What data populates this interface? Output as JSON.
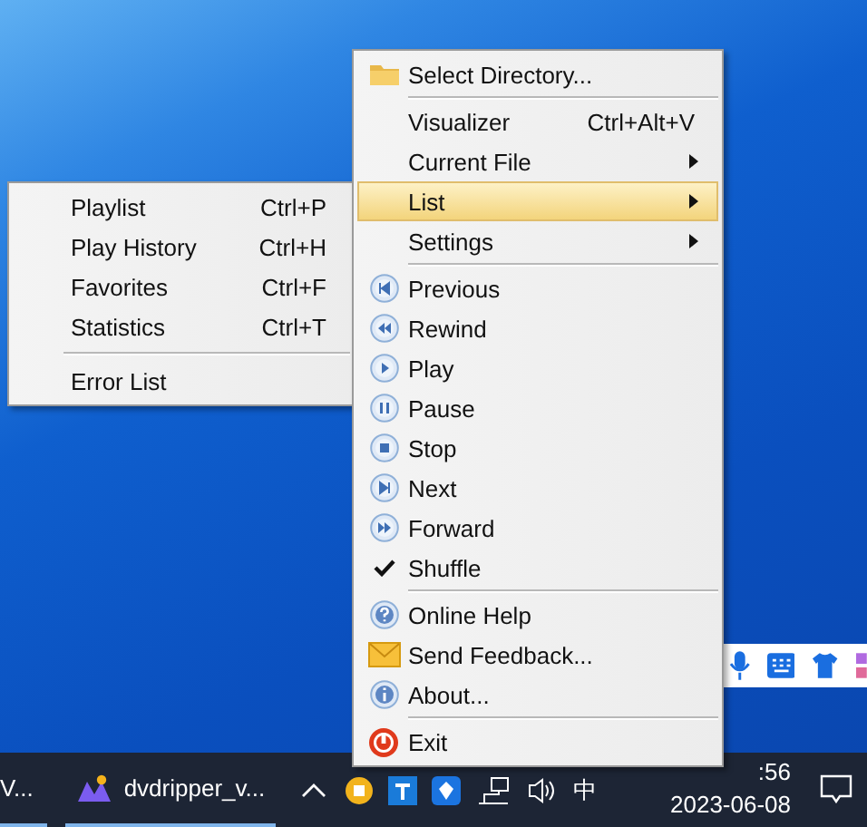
{
  "main_menu": {
    "items": [
      {
        "kind": "folder",
        "label": "Select Directory...",
        "selected": false,
        "checked": false
      },
      {
        "kind": "separator"
      },
      {
        "kind": "plain",
        "label": "Visualizer",
        "shortcut": "Ctrl+Alt+V",
        "selected": false,
        "checked": false
      },
      {
        "kind": "plain",
        "label": "Current File",
        "submenu": true,
        "selected": false,
        "checked": false
      },
      {
        "kind": "plain",
        "label": "List",
        "submenu": true,
        "selected": true,
        "checked": false
      },
      {
        "kind": "plain",
        "label": "Settings",
        "submenu": true,
        "selected": false,
        "checked": false
      },
      {
        "kind": "separator"
      },
      {
        "kind": "previous",
        "label": "Previous",
        "selected": false,
        "checked": false
      },
      {
        "kind": "rewind",
        "label": "Rewind",
        "selected": false,
        "checked": false
      },
      {
        "kind": "play",
        "label": "Play",
        "selected": false,
        "checked": false
      },
      {
        "kind": "pause",
        "label": "Pause",
        "selected": false,
        "checked": false
      },
      {
        "kind": "stop",
        "label": "Stop",
        "selected": false,
        "checked": false
      },
      {
        "kind": "next",
        "label": "Next",
        "selected": false,
        "checked": false
      },
      {
        "kind": "forward",
        "label": "Forward",
        "selected": false,
        "checked": false
      },
      {
        "kind": "plain",
        "label": "Shuffle",
        "selected": false,
        "checked": true
      },
      {
        "kind": "separator"
      },
      {
        "kind": "help",
        "label": "Online Help",
        "selected": false,
        "checked": false
      },
      {
        "kind": "mail",
        "label": "Send Feedback...",
        "selected": false,
        "checked": false
      },
      {
        "kind": "info",
        "label": "About...",
        "selected": false,
        "checked": false
      },
      {
        "kind": "separator"
      },
      {
        "kind": "exit",
        "label": "Exit",
        "selected": false,
        "checked": false
      }
    ]
  },
  "list_submenu": {
    "items": [
      {
        "kind": "plain",
        "label": "Playlist",
        "shortcut": "Ctrl+P",
        "selected": false
      },
      {
        "kind": "plain",
        "label": "Play History",
        "shortcut": "Ctrl+H",
        "selected": false
      },
      {
        "kind": "plain",
        "label": "Favorites",
        "shortcut": "Ctrl+F",
        "selected": false
      },
      {
        "kind": "plain",
        "label": "Statistics",
        "shortcut": "Ctrl+T",
        "selected": false
      },
      {
        "kind": "separator"
      },
      {
        "kind": "plain",
        "label": "Error List",
        "selected": false
      }
    ]
  },
  "taskbar": {
    "windows": [
      {
        "label": "V..."
      },
      {
        "label": "dvdripper_v..."
      }
    ],
    "ime": "中",
    "clock": {
      "time": ":56",
      "date": "2023-06-08"
    }
  }
}
